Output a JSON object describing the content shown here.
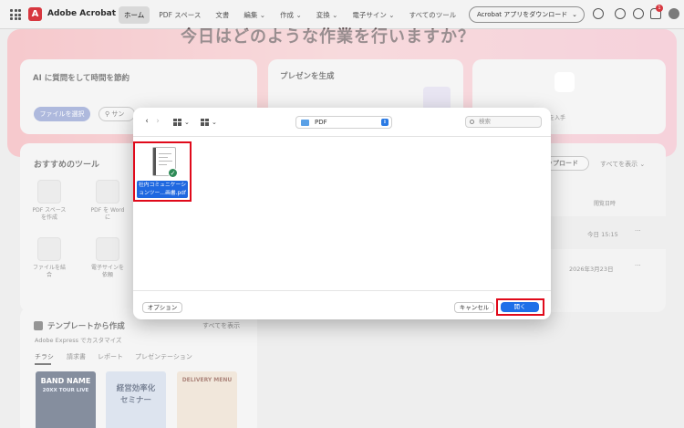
{
  "app": {
    "title": "Adobe Acrobat",
    "logo_letter": "A"
  },
  "nav": {
    "items": [
      {
        "label": "ホーム",
        "active": true
      },
      {
        "label": "PDF スペース",
        "active": false
      },
      {
        "label": "文書",
        "active": false
      },
      {
        "label": "編集 ⌄",
        "active": false
      },
      {
        "label": "作成 ⌄",
        "active": false
      },
      {
        "label": "変換 ⌄",
        "active": false
      },
      {
        "label": "電子サイン ⌄",
        "active": false
      },
      {
        "label": "すべてのツール",
        "active": false
      }
    ],
    "download_label": "Acrobat アプリをダウンロード",
    "notification_count": "1"
  },
  "hero": {
    "title": "今日はどのような作業を行いますか？"
  },
  "ai_card": {
    "title": "AI に質問をして時間を節約",
    "select_file": "ファイルを選択",
    "sample": "サン"
  },
  "present_card": {
    "title": "プレゼンを生成"
  },
  "right_card": {
    "subtitle": "を入手"
  },
  "recommended": {
    "title": "おすすめのツール",
    "tools": [
      {
        "label": "PDF スペースを作成"
      },
      {
        "label": "PDF を Word に"
      },
      {
        "label": "ファイルを結合"
      },
      {
        "label": "電子サインを依頼"
      }
    ]
  },
  "recent": {
    "upload": "ップロード",
    "show_all": "すべてを表示 ⌄",
    "col_opened": "閲覧日時",
    "rows": [
      {
        "time": "今日 15:15",
        "more": "···"
      },
      {
        "time": "2026年3月23日",
        "more": "···"
      }
    ]
  },
  "templates": {
    "title": "テンプレートから作成",
    "show_all": "すべてを表示",
    "subtitle": "Adobe Express でカスタマイズ",
    "tabs": [
      "チラシ",
      "請求書",
      "レポート",
      "プレゼンテーション"
    ],
    "thumbs": [
      {
        "line1": "BAND NAME",
        "line2": "20XX TOUR LIVE"
      },
      {
        "line1": "経営効率化",
        "line2": "セミナー"
      },
      {
        "line1": "DELIVERY MENU",
        "line2": ""
      }
    ]
  },
  "dialog": {
    "view_icons_label": "⌄",
    "view_list_label": "⌄",
    "location": "PDF",
    "search_placeholder": "検索",
    "file": {
      "name": "社内コミュニケーションツー…画書.pdf"
    },
    "options": "オプション",
    "cancel": "キャンセル",
    "open": "開く"
  },
  "colors": {
    "accent": "#1f6fe8",
    "highlight": "#e00a1b",
    "brand": "#d7373f"
  }
}
